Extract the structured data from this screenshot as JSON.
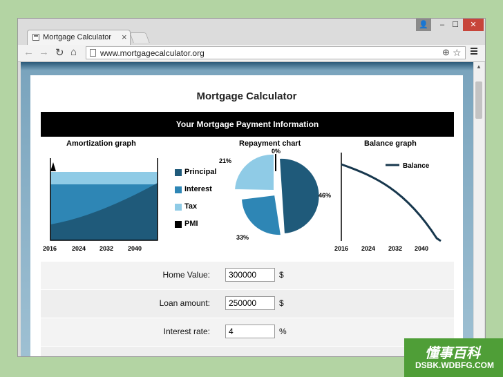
{
  "browser": {
    "tab_title": "Mortgage Calculator",
    "tab_close": "×",
    "url": "www.mortgagecalculator.org",
    "window_buttons": {
      "user": "👤",
      "minimize": "–",
      "maximize": "☐",
      "close": "✕"
    },
    "nav": {
      "back": "←",
      "forward": "→",
      "reload": "↻",
      "home": "⌂"
    },
    "zoom_icon": "⊕",
    "star_icon": "☆"
  },
  "page": {
    "title": "Mortgage Calculator",
    "banner": "Your Mortgage Payment Information"
  },
  "charts": {
    "amortization": {
      "title": "Amortization graph",
      "x_ticks": [
        "2016",
        "2024",
        "2032",
        "2040"
      ],
      "legend": [
        {
          "label": "Principal",
          "color": "#1f5a7a"
        },
        {
          "label": "Interest",
          "color": "#2e86b5"
        },
        {
          "label": "Tax",
          "color": "#8fcbe6"
        },
        {
          "label": "PMI",
          "color": "#000000"
        }
      ]
    },
    "repayment": {
      "title": "Repayment chart",
      "labels": [
        "0%",
        "21%",
        "46%",
        "33%"
      ]
    },
    "balance": {
      "title": "Balance graph",
      "legend_label": "Balance",
      "x_ticks": [
        "2016",
        "2024",
        "2032",
        "2040"
      ]
    }
  },
  "chart_data": [
    {
      "type": "area",
      "title": "Amortization graph",
      "categories": [
        "2016",
        "2024",
        "2032",
        "2040"
      ],
      "series": [
        {
          "name": "Principal",
          "color": "#1f5a7a"
        },
        {
          "name": "Interest",
          "color": "#2e86b5"
        },
        {
          "name": "Tax",
          "color": "#8fcbe6"
        },
        {
          "name": "PMI",
          "color": "#000000"
        }
      ]
    },
    {
      "type": "pie",
      "title": "Repayment chart",
      "slices": [
        {
          "label": "46%",
          "value": 46,
          "color": "#1f5a7a"
        },
        {
          "label": "33%",
          "value": 33,
          "color": "#2e86b5"
        },
        {
          "label": "21%",
          "value": 21,
          "color": "#8fcbe6"
        },
        {
          "label": "0%",
          "value": 0,
          "color": "#000000"
        }
      ]
    },
    {
      "type": "line",
      "title": "Balance graph",
      "categories": [
        "2016",
        "2024",
        "2032",
        "2040"
      ],
      "series": [
        {
          "name": "Balance",
          "color": "#17374d"
        }
      ]
    }
  ],
  "form": {
    "rows": [
      {
        "label": "Home Value:",
        "value": "300000",
        "unit": "$"
      },
      {
        "label": "Loan amount:",
        "value": "250000",
        "unit": "$"
      },
      {
        "label": "Interest rate:",
        "value": "4",
        "unit": "%"
      }
    ]
  },
  "watermark": {
    "cn": "懂事百科",
    "en": "DSBK.WDBFG.COM"
  }
}
